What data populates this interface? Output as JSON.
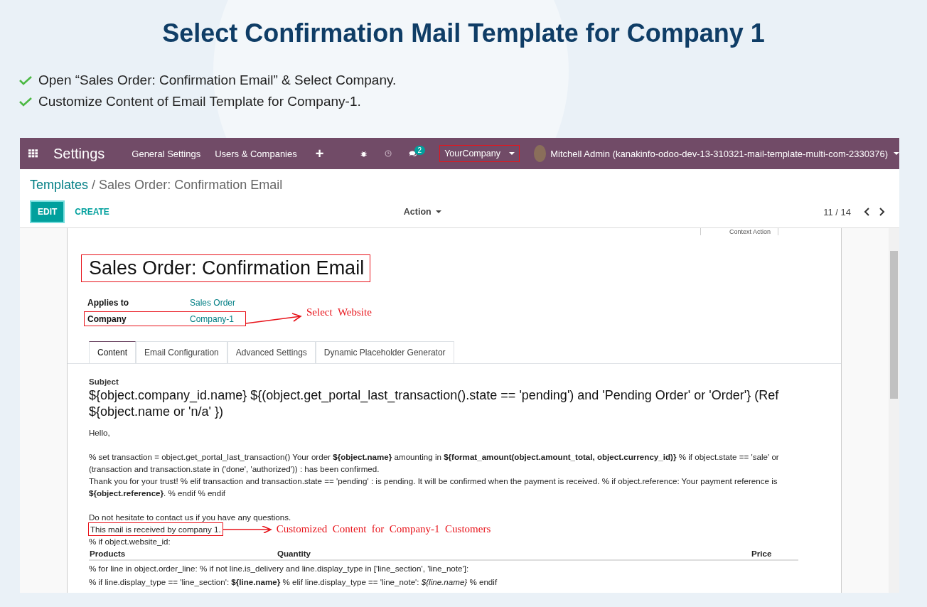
{
  "heading": "Select Confirmation Mail Template for Company 1",
  "checklist": [
    "Open “Sales Order: Confirmation Email” & Select Company.",
    "Customize Content of Email Template for Company-1."
  ],
  "navbar": {
    "app_title": "Settings",
    "menu": [
      "General Settings",
      "Users & Companies"
    ],
    "add": "+",
    "message_count": "2",
    "company": "YourCompany",
    "user": "Mitchell Admin (kanakinfo-odoo-dev-13-310321-mail-template-multi-com-2330376)"
  },
  "breadcrumb": {
    "parent": "Templates",
    "separator": "/",
    "current": "Sales Order: Confirmation Email"
  },
  "toolbar": {
    "edit": "EDIT",
    "create": "CREATE",
    "action": "Action",
    "pager": "11 / 14"
  },
  "form": {
    "stat_button": "Context Action",
    "title": "Sales Order: Confirmation Email",
    "title_highlighted": true,
    "fields": [
      {
        "label": "Applies to",
        "value": "Sales Order",
        "highlighted": false
      },
      {
        "label": "Company",
        "value": "Company-1",
        "highlighted": true,
        "annotation": "Select  Website"
      }
    ],
    "tabs": [
      {
        "label": "Content",
        "selected": true
      },
      {
        "label": "Email Configuration",
        "selected": false
      },
      {
        "label": "Advanced Settings",
        "selected": false
      },
      {
        "label": "Dynamic Placeholder Generator",
        "selected": false
      }
    ],
    "subject_label": "Subject",
    "subject": "${object.company_id.name} ${(object.get_portal_last_transaction().state == 'pending') and 'Pending Order' or 'Order'} (Ref ${object.name or 'n/a' })",
    "body": [
      {
        "lines": [
          {
            "text": "Hello,",
            "highlighted": false
          }
        ]
      },
      {
        "lines": [
          {
            "text": "% set transaction = object.get_portal_last_transaction() Your order **${object.name}** amounting in **${format_amount(object.amount_total, object.currency_id)}** % if object.state == 'sale' or (transaction and transaction.state in ('done', 'authorized')) : has been confirmed.",
            "highlighted": false
          },
          {
            "text": "Thank you for your trust! % elif transaction and transaction.state == 'pending' : is pending. It will be confirmed when the payment is received. % if object.reference: Your payment reference is **${object.reference}**. % endif % endif",
            "highlighted": false
          }
        ]
      },
      {
        "lines": [
          {
            "text": "Do not hesitate to contact us if you have any questions.",
            "highlighted": false
          },
          {
            "text": "This mail is received by company 1.",
            "highlighted": true,
            "annotation": "Customized  Content  for  Company-1  Customers"
          },
          {
            "text": "% if object.website_id:",
            "highlighted": false
          }
        ]
      }
    ],
    "table_columns": [
      "Products",
      "Quantity",
      "Price"
    ],
    "table_lines": [
      "% for line in object.order_line: % if not line.is_delivery and line.display_type in ['line_section', 'line_note']:",
      "% if line.display_type == 'line_section': **${line.name}** % elif line.display_type == 'line_note': *${line.name}* % endif"
    ]
  }
}
